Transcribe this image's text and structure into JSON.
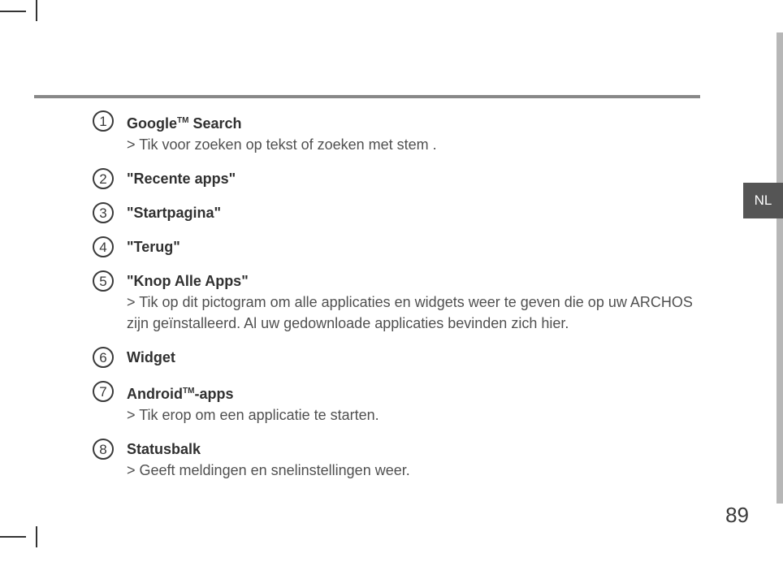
{
  "language_tab": "NL",
  "page_number": "89",
  "items": [
    {
      "num": "1",
      "title_pre": "Google",
      "title_tm": "TM",
      "title_post": " Search",
      "desc": "> Tik voor zoeken op tekst of zoeken met stem ."
    },
    {
      "num": "2",
      "title_pre": "\"Recente apps\"",
      "title_tm": "",
      "title_post": "",
      "desc": ""
    },
    {
      "num": "3",
      "title_pre": "\"Startpagina\"",
      "title_tm": "",
      "title_post": "",
      "desc": ""
    },
    {
      "num": "4",
      "title_pre": "\"Terug\"",
      "title_tm": "",
      "title_post": "",
      "desc": ""
    },
    {
      "num": "5",
      "title_pre": "\"Knop Alle Apps\"",
      "title_tm": "",
      "title_post": "",
      "desc": "> Tik op dit pictogram om alle applicaties en widgets weer te geven die op uw ARCHOS zijn geïnstalleerd. Al uw gedownloade applicaties bevinden zich hier."
    },
    {
      "num": "6",
      "title_pre": "Widget",
      "title_tm": "",
      "title_post": "",
      "desc": ""
    },
    {
      "num": "7",
      "title_pre": "Android",
      "title_tm": "TM",
      "title_post": "-apps",
      "desc": "> Tik erop om een applicatie te starten."
    },
    {
      "num": "8",
      "title_pre": "Statusbalk",
      "title_tm": "",
      "title_post": "",
      "desc": "> Geeft meldingen en snelinstellingen weer."
    }
  ]
}
